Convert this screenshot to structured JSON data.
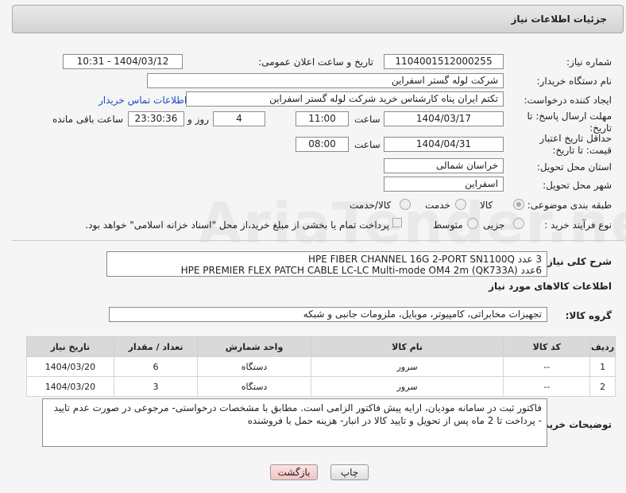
{
  "header": {
    "title": "جزئیات اطلاعات نیاز"
  },
  "labels": {
    "need_number": "شماره نیاز:",
    "announce_datetime": "تاریخ و ساعت اعلان عمومی:",
    "buyer_org": "نام دستگاه خریدار:",
    "requester": "ایجاد کننده درخواست:",
    "contact_link": "اطلاعات تماس خریدار",
    "send_deadline": "مهلت ارسال پاسخ: تا تاریخ:",
    "time": "ساعت",
    "day_and": "روز و",
    "remaining": "ساعت باقی مانده",
    "price_validity": "حداقل تاریخ اعتبار قیمت: تا تاریخ:",
    "province": "استان محل تحویل:",
    "city": "شهر محل تحویل:",
    "category": "طبقه بندی موضوعی:",
    "purchase_type": "نوع فرآیند خرید :",
    "description_title": "شرح کلی نیاز:",
    "goods_info": "اطلاعات کالاهای مورد نیاز",
    "goods_group": "گروه کالا:",
    "buyer_notes": "توضیحات خریدار:"
  },
  "fields": {
    "need_number": "1104001512000255",
    "announce_datetime": "1404/03/12 - 10:31",
    "buyer_org": "شرکت لوله گستر اسفراین",
    "requester": "تکتم ایران پناه کارشناس خرید شرکت لوله گستر اسفراین",
    "send_date": "1404/03/17",
    "send_time": "11:00",
    "days": "4",
    "remaining_time": "23:30:36",
    "validity_date": "1404/04/31",
    "validity_time": "08:00",
    "province": "خراسان شمالی",
    "city": "اسفراین",
    "goods_group": "تجهیزات مخابراتی، کامپیوتر، موبایل، ملزومات جانبی و شبکه"
  },
  "category_options": [
    "کالا",
    "خدمت",
    "کالا/خدمت"
  ],
  "purchase_options": [
    "جزیی",
    "متوسط"
  ],
  "payment_note": "پرداخت تمام یا بخشی از مبلغ خرید،از محل \"اسناد خزانه اسلامی\" خواهد بود.",
  "description": {
    "line1": "3 عدد       HPE FIBER CHANNEL 16G 2-PORT SN1100Q",
    "line2": "6عدد HPE PREMIER FLEX PATCH CABLE LC-LC Multi-mode OM4 2m (QK733A)"
  },
  "table": {
    "headers": [
      "ردیف",
      "کد کالا",
      "نام کالا",
      "واحد شمارش",
      "تعداد / مقدار",
      "تاریخ نیاز"
    ],
    "rows": [
      [
        "1",
        "--",
        "سرور",
        "دستگاه",
        "6",
        "1404/03/20"
      ],
      [
        "2",
        "--",
        "سرور",
        "دستگاه",
        "3",
        "1404/03/20"
      ]
    ]
  },
  "notes": "فاکتور ثبت در سامانه مودیان، ارایه پیش فاکتور الزامی است. مطابق با مشخصات درخواستی- مرجوعی در صورت عدم تایید - پرداخت تا 2 ماه پس از تحویل و تایید کالا در انبار- هزینه حمل با فروشنده",
  "buttons": {
    "print": "چاپ",
    "back": "بازگشت"
  },
  "watermark": "AriaTender.neT"
}
